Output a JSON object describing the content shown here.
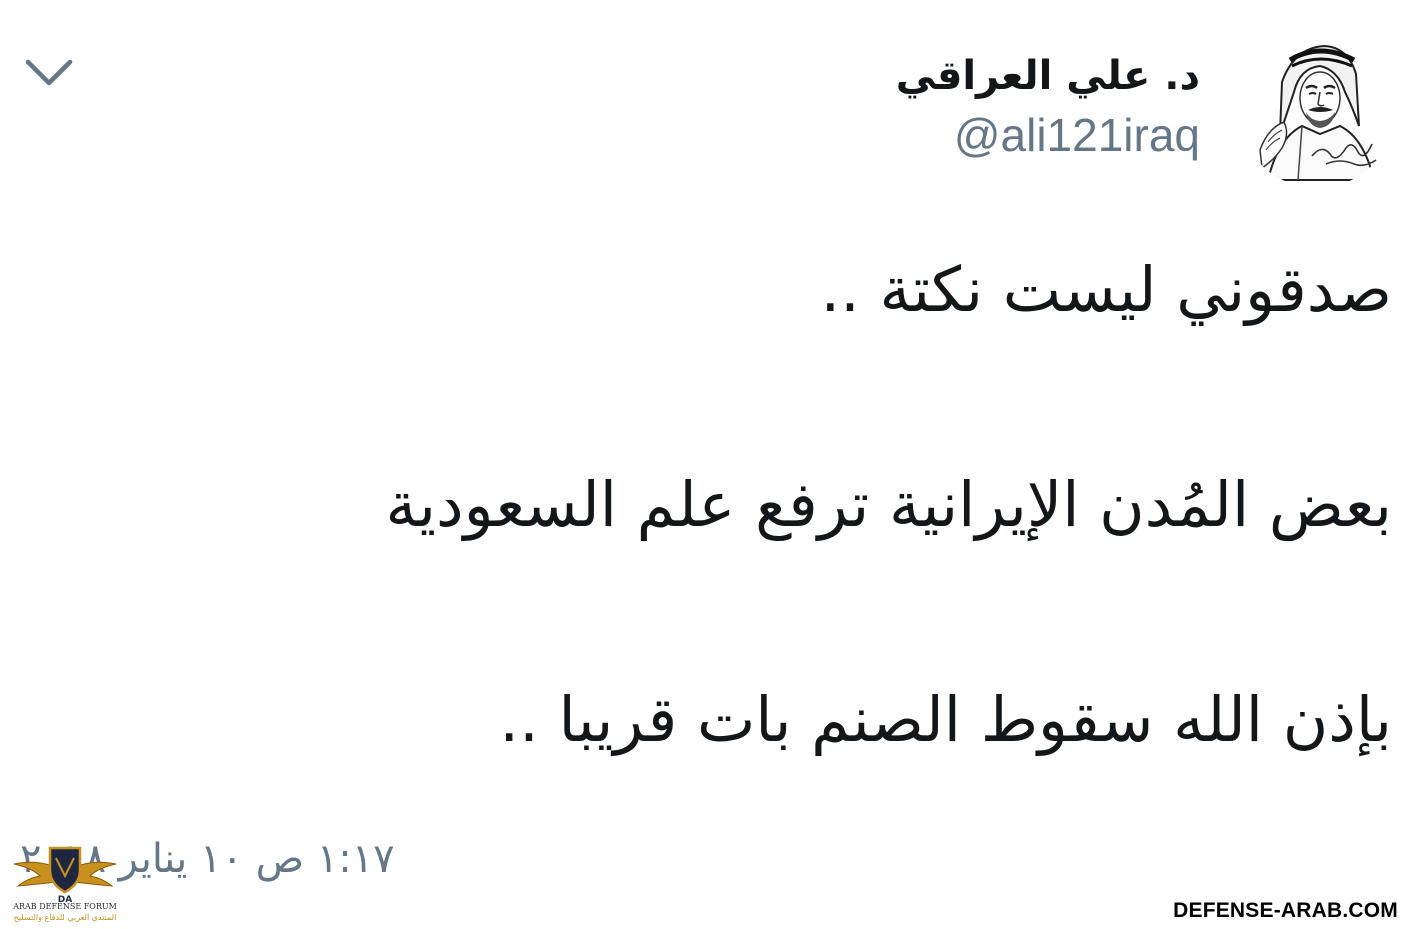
{
  "tweet": {
    "author": {
      "display_name": "د. علي العراقي",
      "handle": "@ali121iraq"
    },
    "text_lines": [
      "صدقوني ليست نكتة ..",
      "بعض المُدن الإيرانية ترفع علم السعودية",
      "بإذن الله سقوط الصنم بات قريبا .."
    ],
    "timestamp": "١:١٧ ص ١٠ يناير ٢٠١٨",
    "menu_icon": "chevron-down-icon"
  },
  "overlay": {
    "logo_text_en": "ARAB DEFENSE FORUM",
    "logo_text_ar": "المنتدى العربي للدفاع والتسليح",
    "watermark": "DEFENSE-ARAB.COM"
  },
  "colors": {
    "text_primary": "#14171a",
    "text_secondary": "#657786",
    "logo_gold": "#c8901c"
  }
}
